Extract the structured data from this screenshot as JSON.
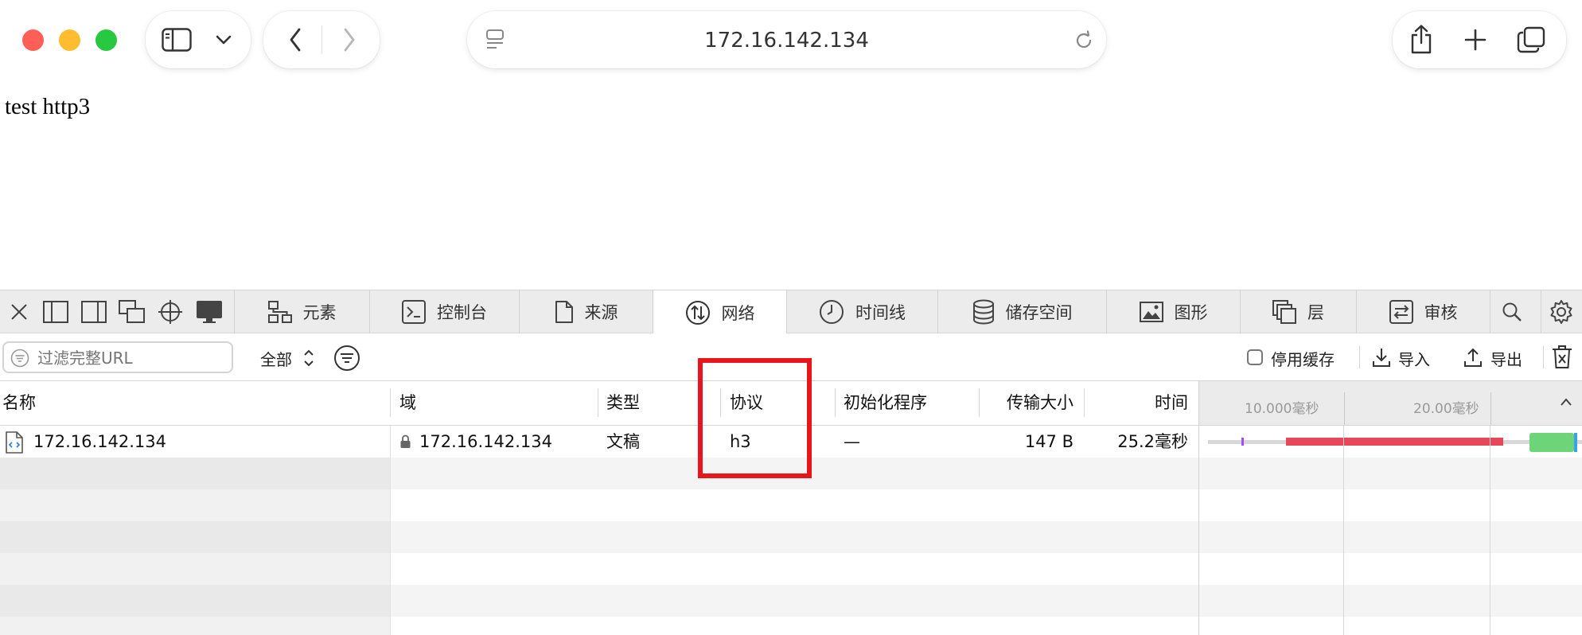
{
  "browser": {
    "url": "172.16.142.134",
    "traffic_lights": {
      "close": "#ff5f57",
      "minimize": "#febc2e",
      "maximize": "#28c840"
    },
    "icons": [
      "sidebar-icon",
      "chevron-down-icon",
      "back-icon",
      "forward-icon",
      "page-menu-icon",
      "reload-icon",
      "share-icon",
      "new-tab-icon",
      "tab-overview-icon"
    ]
  },
  "page": {
    "text": "test http3"
  },
  "devtools": {
    "tabs": [
      {
        "label": "元素",
        "icon": "elements-icon"
      },
      {
        "label": "控制台",
        "icon": "console-icon"
      },
      {
        "label": "来源",
        "icon": "sources-icon"
      },
      {
        "label": "网络",
        "icon": "network-icon",
        "active": true
      },
      {
        "label": "时间线",
        "icon": "timeline-icon"
      },
      {
        "label": "储存空间",
        "icon": "storage-icon"
      },
      {
        "label": "图形",
        "icon": "graphics-icon"
      },
      {
        "label": "层",
        "icon": "layers-icon"
      },
      {
        "label": "审核",
        "icon": "audit-icon"
      }
    ],
    "filter": {
      "placeholder": "过滤完整URL",
      "type_select": "全部",
      "disable_cache_label": "停用缓存",
      "disable_cache_checked": false,
      "import_label": "导入",
      "export_label": "导出"
    },
    "columns": {
      "name": "名称",
      "domain": "域",
      "type": "类型",
      "protocol": "协议",
      "initiator": "初始化程序",
      "transfer_size": "传输大小",
      "time": "时间"
    },
    "waterfall_ticks": [
      "10.000毫秒",
      "20.00毫秒"
    ],
    "requests": [
      {
        "name": "172.16.142.134",
        "domain": "172.16.142.134",
        "type": "文稿",
        "protocol": "h3",
        "initiator": "—",
        "transfer_size": "147 B",
        "time": "25.2毫秒"
      }
    ],
    "highlight_color": "#e8161b",
    "waterfall_colors": {
      "waiting": "#e8475a",
      "receiving": "#6ed47a",
      "dns": "#a64cf2"
    }
  }
}
